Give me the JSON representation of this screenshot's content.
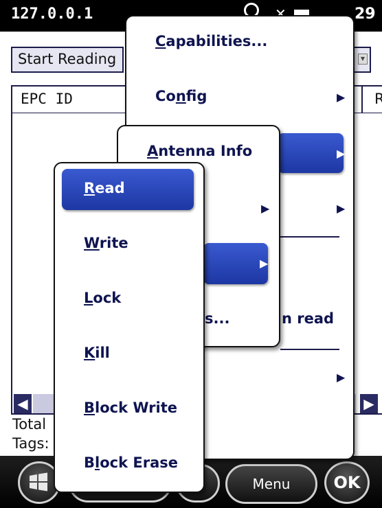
{
  "titlebar": {
    "title": "127.0.0.1",
    "clock": "29"
  },
  "main": {
    "start_reading": "Start Reading",
    "epc_header": "EPC ID",
    "r_header": "R",
    "total_label": "Total",
    "tags_label": "Tags:"
  },
  "bottombar": {
    "menu_label": "Menu",
    "ok_label": "OK"
  },
  "menu1": {
    "capabilities": {
      "accel": "C",
      "rest": "apabilities..."
    },
    "config": {
      "pre": "Co",
      "accel": "n",
      "rest": "fig"
    },
    "partial_read": "n read"
  },
  "menu2": {
    "antenna_info": {
      "accel": "A",
      "rest": "ntenna Info"
    },
    "partial_filters": "s..."
  },
  "menu3": {
    "read": {
      "accel": "R",
      "rest": "ead"
    },
    "write": {
      "accel": "W",
      "rest": "rite"
    },
    "lock": {
      "accel": "L",
      "rest": "ock"
    },
    "kill": {
      "accel": "K",
      "rest": "ill"
    },
    "block_write": {
      "accel": "B",
      "rest": "lock Write"
    },
    "block_erase": {
      "pre": "B",
      "accel": "l",
      "rest": "ock Erase"
    }
  },
  "icons": {
    "scroll_left": "◀",
    "scroll_right": "▶",
    "submenu_arrow": "▶",
    "combo_arrow": "▼"
  },
  "colors": {
    "menu_text": "#0f1450",
    "highlight": "#2a47c0",
    "titlebar_bg": "#000000"
  }
}
